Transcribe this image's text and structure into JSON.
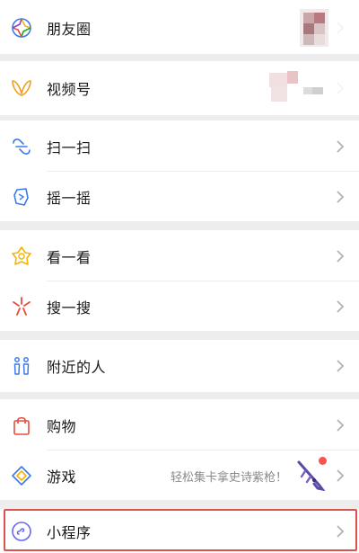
{
  "menu": {
    "moments": {
      "label": "朋友圈",
      "icon": "moments-aperture-icon"
    },
    "channels": {
      "label": "视频号",
      "icon": "channels-butterfly-icon"
    },
    "scan": {
      "label": "扫一扫",
      "icon": "scan-icon"
    },
    "shake": {
      "label": "摇一摇",
      "icon": "shake-icon"
    },
    "top_stories": {
      "label": "看一看",
      "icon": "top-stories-icon"
    },
    "search": {
      "label": "搜一搜",
      "icon": "search-star-icon"
    },
    "nearby": {
      "label": "附近的人",
      "icon": "nearby-people-icon"
    },
    "shopping": {
      "label": "购物",
      "icon": "shopping-bag-icon"
    },
    "games": {
      "label": "游戏",
      "icon": "games-diamond-icon",
      "promo": "轻松集卡拿史诗紫枪！"
    },
    "mini_programs": {
      "label": "小程序",
      "icon": "mini-programs-icon"
    }
  },
  "colors": {
    "background": "#ededed",
    "card": "#ffffff",
    "text": "#191919",
    "badge_red": "#fa5151",
    "highlight_border": "#d9534f"
  }
}
